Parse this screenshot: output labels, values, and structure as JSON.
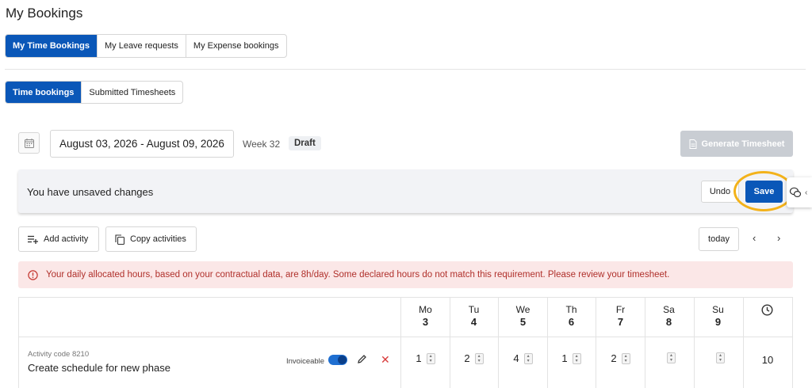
{
  "page": {
    "title": "My Bookings"
  },
  "tabs_primary": [
    {
      "label": "My Time Bookings",
      "active": true
    },
    {
      "label": "My Leave requests",
      "active": false
    },
    {
      "label": "My Expense bookings",
      "active": false
    }
  ],
  "tabs_secondary": [
    {
      "label": "Time bookings",
      "active": true
    },
    {
      "label": "Submitted Timesheets",
      "active": false
    }
  ],
  "period": {
    "range": "August 03, 2026 - August 09, 2026",
    "week": "Week 32",
    "status": "Draft",
    "calendar_icon": "calendar-icon"
  },
  "generate_button": {
    "label": "Generate Timesheet",
    "icon": "document-icon",
    "disabled": true
  },
  "unsaved_banner": {
    "message": "You have unsaved changes",
    "undo_label": "Undo",
    "save_label": "Save",
    "chat_icon": "chat-bubbles-icon"
  },
  "toolbar": {
    "add_activity": "Add activity",
    "copy_activities": "Copy activities",
    "today": "today"
  },
  "alert": {
    "message": "Your daily allocated hours, based on your contractual data, are 8h/day. Some declared hours do not match this requirement. Please review your timesheet.",
    "icon": "alert-circle-icon"
  },
  "days": [
    {
      "name": "Mo",
      "num": "3"
    },
    {
      "name": "Tu",
      "num": "4"
    },
    {
      "name": "We",
      "num": "5"
    },
    {
      "name": "Th",
      "num": "6"
    },
    {
      "name": "Fr",
      "num": "7"
    },
    {
      "name": "Sa",
      "num": "8"
    },
    {
      "name": "Su",
      "num": "9"
    }
  ],
  "activity": {
    "code": "Activity code 8210",
    "name": "Create schedule for new phase",
    "invoiceable_label": "Invoiceable",
    "invoiceable": true,
    "hours": [
      "1",
      "2",
      "4",
      "1",
      "2",
      "",
      ""
    ],
    "total": "10"
  },
  "colors": {
    "primary": "#0a57b8",
    "highlight": "#f3b21a",
    "alert_bg": "#fbe7e7",
    "alert_text": "#b0302b",
    "delete": "#d83a3a"
  }
}
